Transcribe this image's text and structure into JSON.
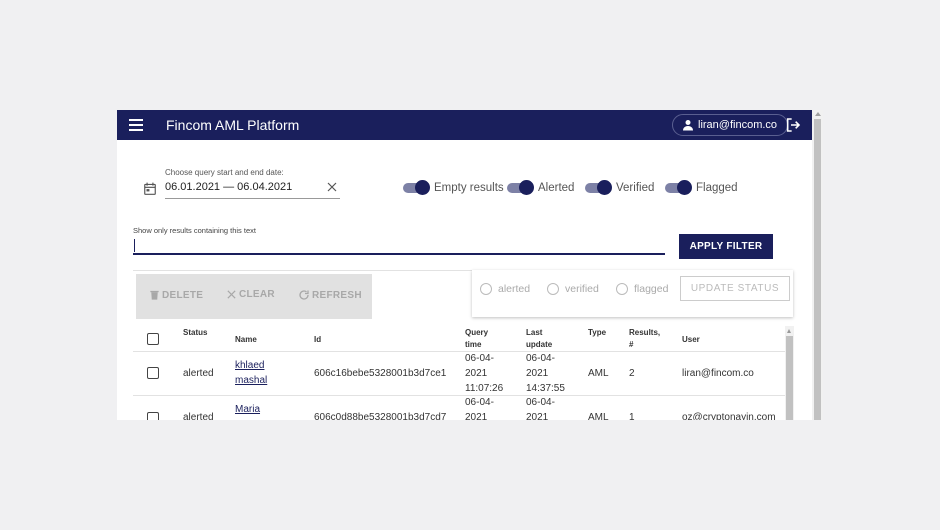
{
  "app": {
    "title": "Fincom AML Platform",
    "user_email": "liran@fincom.co"
  },
  "filters": {
    "date_label": "Choose query start and end date:",
    "date_value": "06.01.2021 — 06.04.2021",
    "toggles": [
      {
        "label": "Empty results",
        "on": true
      },
      {
        "label": "Alerted",
        "on": true
      },
      {
        "label": "Verified",
        "on": true
      },
      {
        "label": "Flagged",
        "on": true
      }
    ],
    "text_label": "Show only results containing this text",
    "text_value": "",
    "apply_label": "APPLY FILTER"
  },
  "actions": {
    "delete_label": "DELETE",
    "clear_label": "CLEAR",
    "refresh_label": "REFRESH"
  },
  "status_update": {
    "options": [
      "alerted",
      "verified",
      "flagged"
    ],
    "update_label": "UPDATE STATUS"
  },
  "table": {
    "columns": [
      "Status",
      "Name",
      "Id",
      "Query time",
      "Last update",
      "Type",
      "Results, #",
      "User"
    ],
    "rows": [
      {
        "status": "alerted",
        "name_line1": "khlaed",
        "name_line2": "mashal",
        "id": "606c16bebe5328001b3d7ce1",
        "query_date_a": "06-04-",
        "query_date_b": "2021",
        "query_time": "11:07:26",
        "update_date_a": "06-04-",
        "update_date_b": "2021",
        "update_time": "14:37:55",
        "type": "AML",
        "results": "2",
        "user": "liran@fincom.co"
      },
      {
        "status": "alerted",
        "name_line1": "Maria",
        "name_line2": "",
        "id": "606c0d88be5328001b3d7cd7",
        "query_date_a": "06-04-",
        "query_date_b": "2021",
        "query_time": "",
        "update_date_a": "06-04-",
        "update_date_b": "2021",
        "update_time": "",
        "type": "AML",
        "results": "1",
        "user": "oz@cryptonayin.com"
      }
    ]
  },
  "colors": {
    "brand": "#1a1f5c",
    "toggle_track": "#7d81a6",
    "disabled_bar": "#e1e1e1"
  }
}
